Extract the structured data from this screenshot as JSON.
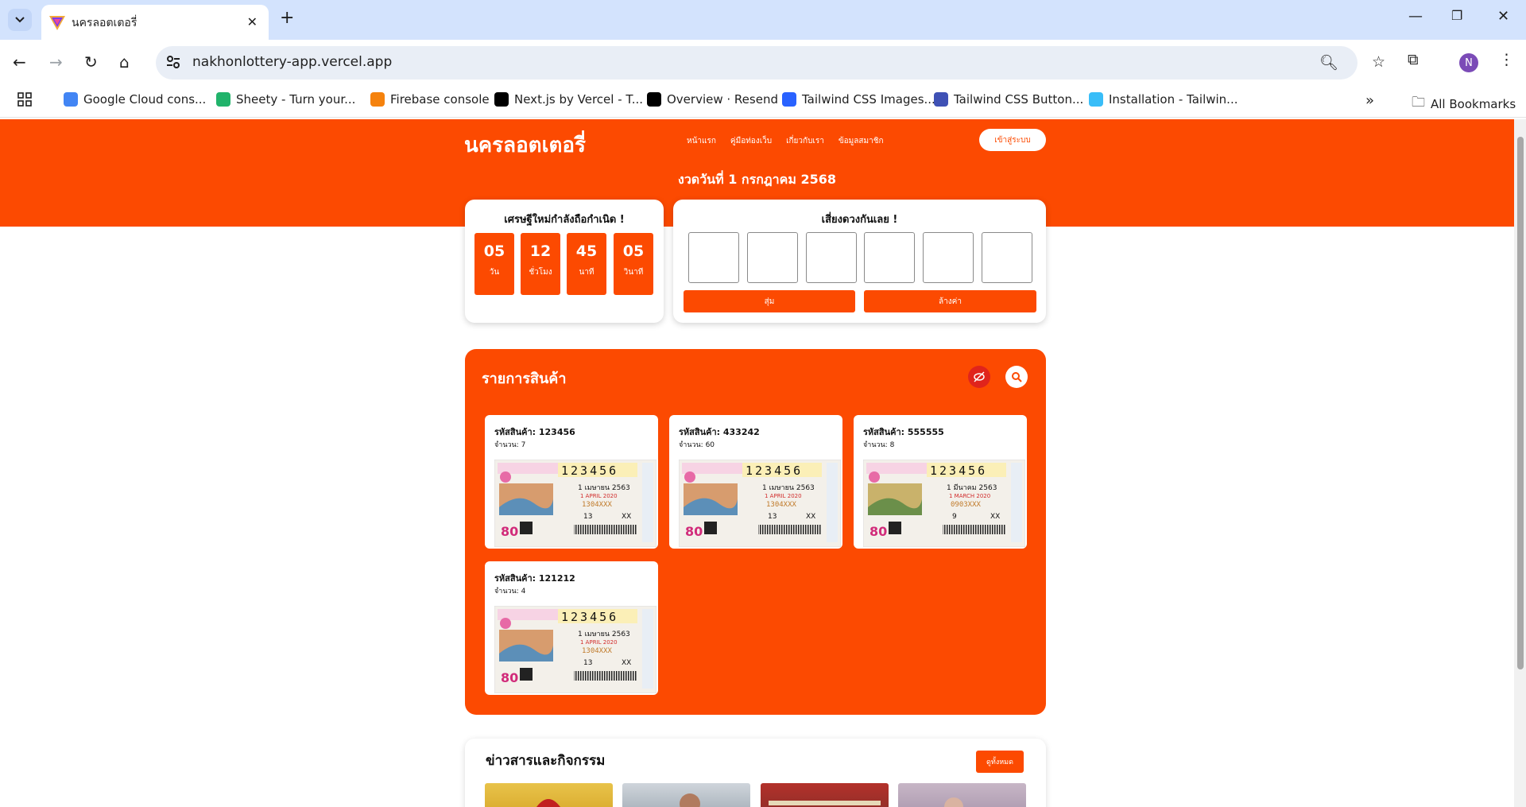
{
  "browser": {
    "tab_title": "นครลอตเตอรี่",
    "url": "nakhonlottery-app.vercel.app",
    "avatar_letter": "N",
    "bookmarks": [
      {
        "label": "Google Cloud cons...",
        "icon": "google-cloud-icon",
        "color": "#4285f4"
      },
      {
        "label": "Sheety - Turn your...",
        "icon": "sheety-icon",
        "color": "#21b36b"
      },
      {
        "label": "Firebase console",
        "icon": "firebase-icon",
        "color": "#f5820d"
      },
      {
        "label": "Next.js by Vercel - T...",
        "icon": "nextjs-icon",
        "color": "#000000"
      },
      {
        "label": "Overview · Resend",
        "icon": "resend-icon",
        "color": "#000000"
      },
      {
        "label": "Tailwind CSS Images...",
        "icon": "tailwind-images-icon",
        "color": "#2962ff"
      },
      {
        "label": "Tailwind CSS Button...",
        "icon": "tailwind-button-icon",
        "color": "#3f51b5"
      },
      {
        "label": "Installation - Tailwin...",
        "icon": "tailwind-icon",
        "color": "#38bdf8"
      }
    ],
    "all_bookmarks": "All Bookmarks"
  },
  "site": {
    "logo": "นครลอตเตอรี่",
    "nav": [
      "หน้าแรก",
      "คู่มือท่องเว็บ",
      "เกี่ยวกับเรา",
      "ข้อมูลสมาชิก"
    ],
    "login": "เข้าสู่ระบบ",
    "draw_date": "งวดวันที่ 1 กรกฎาคม 2568",
    "accent": "#fc4a01"
  },
  "countdown": {
    "title": "เศรษฐีใหม่กำลังถือกำเนิด !",
    "units": [
      {
        "value": "05",
        "label": "วัน"
      },
      {
        "value": "12",
        "label": "ชั่วโมง"
      },
      {
        "value": "45",
        "label": "นาที"
      },
      {
        "value": "05",
        "label": "วินาที"
      }
    ]
  },
  "lucky": {
    "title": "เสี่ยงดวงกันเลย !",
    "random_btn": "สุ่ม",
    "clear_btn": "ล้างค่า"
  },
  "products": {
    "title": "รายการสินค้า",
    "items": [
      {
        "code": "รหัสสินค้า: 123456",
        "qty": "จำนวน: 7",
        "ticket_number": "123456",
        "date_th": "1 เมษายน 2563",
        "date_en": "1 APRIL 2020",
        "serial": "1304XXX",
        "set": "13"
      },
      {
        "code": "รหัสสินค้า: 433242",
        "qty": "จำนวน: 60",
        "ticket_number": "123456",
        "date_th": "1 เมษายน 2563",
        "date_en": "1 APRIL 2020",
        "serial": "1304XXX",
        "set": "13"
      },
      {
        "code": "รหัสสินค้า: 555555",
        "qty": "จำนวน: 8",
        "ticket_number": "123456",
        "date_th": "1 มีนาคม 2563",
        "date_en": "1 MARCH 2020",
        "serial": "0903XXX",
        "set": "9"
      },
      {
        "code": "รหัสสินค้า: 121212",
        "qty": "จำนวน: 4",
        "ticket_number": "123456",
        "date_th": "1 เมษายน 2563",
        "date_en": "1 APRIL 2020",
        "serial": "1304XXX",
        "set": "13"
      }
    ]
  },
  "news": {
    "title": "ข่าวสารและกิจกรรม",
    "see_all": "ดูทั้งหมด"
  }
}
